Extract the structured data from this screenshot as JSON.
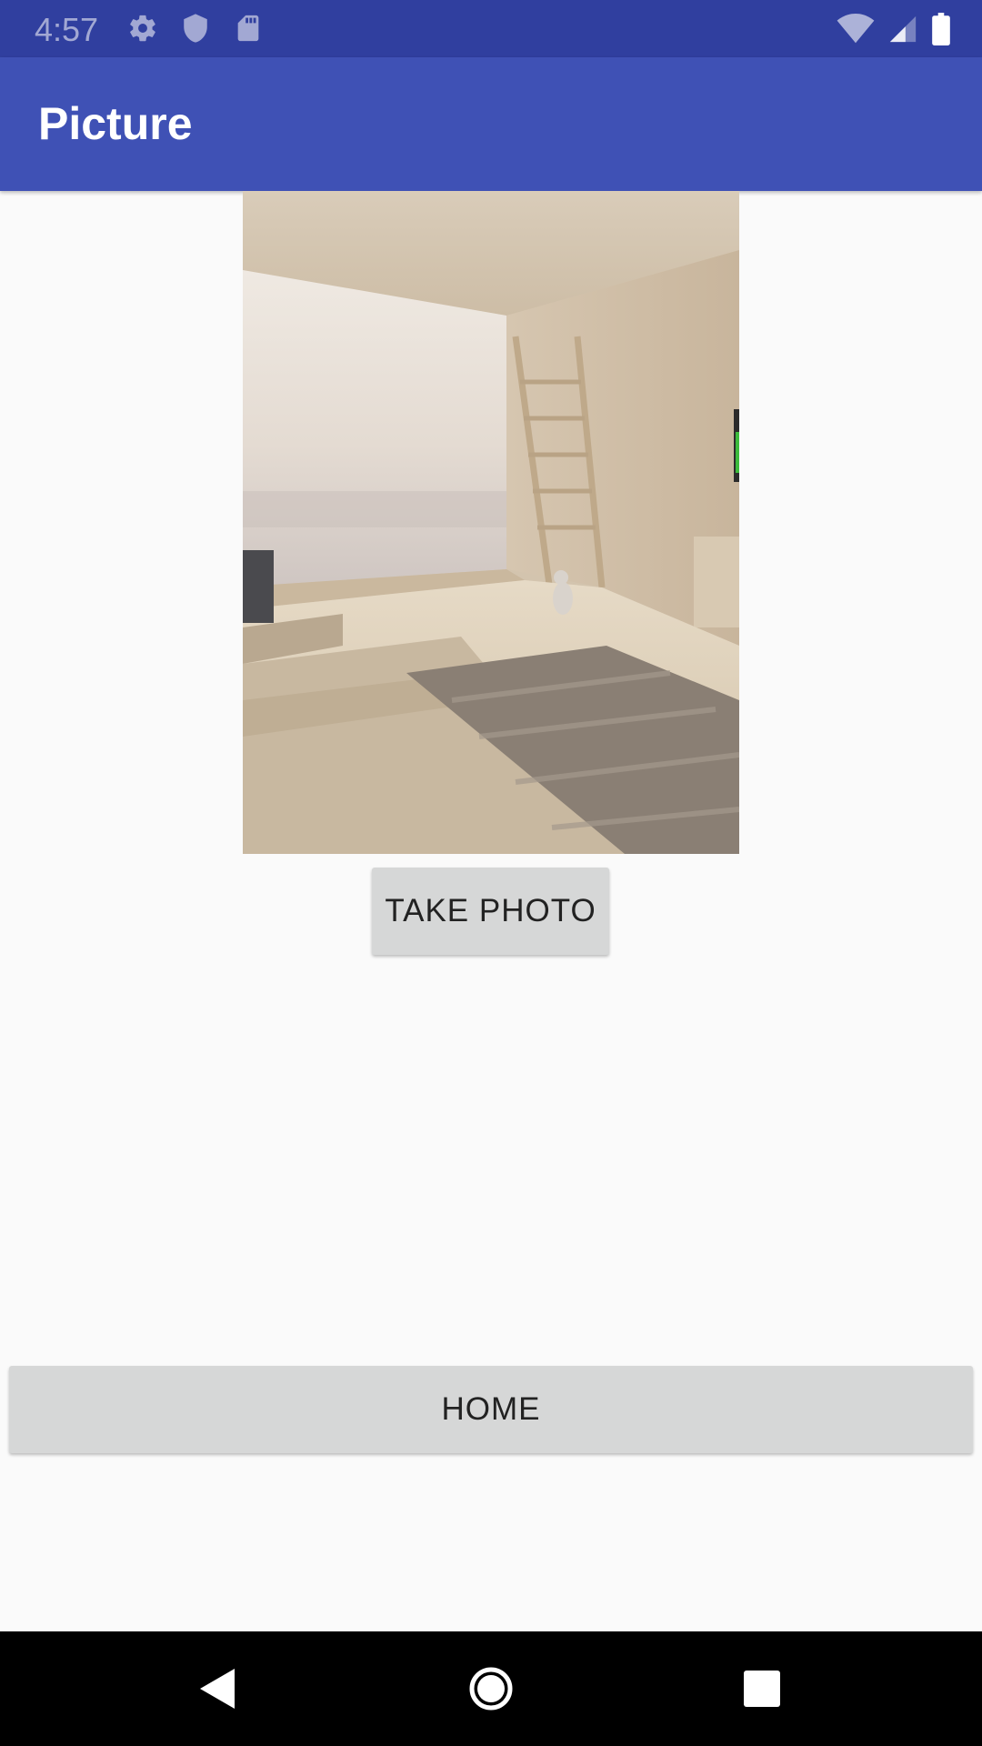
{
  "status_bar": {
    "time": "4:57",
    "left_icons": [
      "gear-icon",
      "shield-icon",
      "sd-card-icon"
    ],
    "right_icons": [
      "wifi-icon",
      "cell-signal-icon",
      "battery-icon"
    ]
  },
  "app_bar": {
    "title": "Picture"
  },
  "main": {
    "photo": {
      "description_icon": "room-photo"
    },
    "take_photo_label": "TAKE PHOTO",
    "home_label": "HOME"
  },
  "nav_bar": {
    "icons": [
      "back-icon",
      "home-circle-icon",
      "recents-icon"
    ]
  },
  "colors": {
    "status_bar": "#303f9f",
    "app_bar": "#3f51b5",
    "background": "#fafafa",
    "button": "#d6d7d7",
    "nav_bar": "#000000"
  }
}
